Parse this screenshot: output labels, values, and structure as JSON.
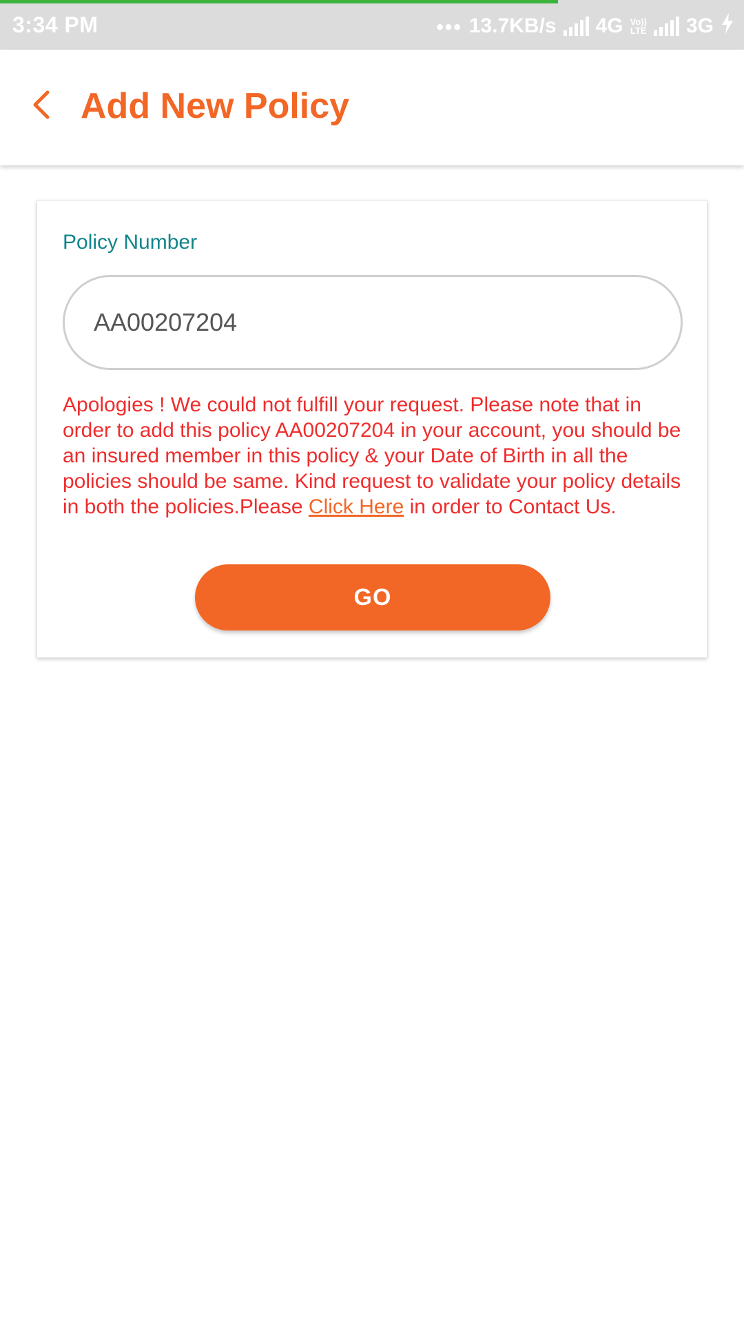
{
  "status_bar": {
    "time": "3:34 PM",
    "dots": "•••",
    "speed": "13.7KB/s",
    "net1": "4G",
    "volte_top": "Vo))",
    "volte_bottom": "LTE",
    "net2": "3G",
    "load_progress": 0.75
  },
  "header": {
    "title": "Add New Policy"
  },
  "form": {
    "policy_label": "Policy Number",
    "policy_value": "AA00207204",
    "error_text_before_link": "Apologies ! We could not fulfill your request. Please note that in order to add this policy AA00207204 in your account, you should be an insured member in this policy & your Date of Birth in all the policies should be same. Kind request to validate your policy details in both the policies.Please ",
    "error_link": "Click Here",
    "error_text_after_link": " in order to Contact Us.",
    "go_label": "GO"
  },
  "colors": {
    "accent": "#f26726",
    "label": "#12858a",
    "error": "#ee2d2d",
    "progress": "#3cb43c"
  }
}
